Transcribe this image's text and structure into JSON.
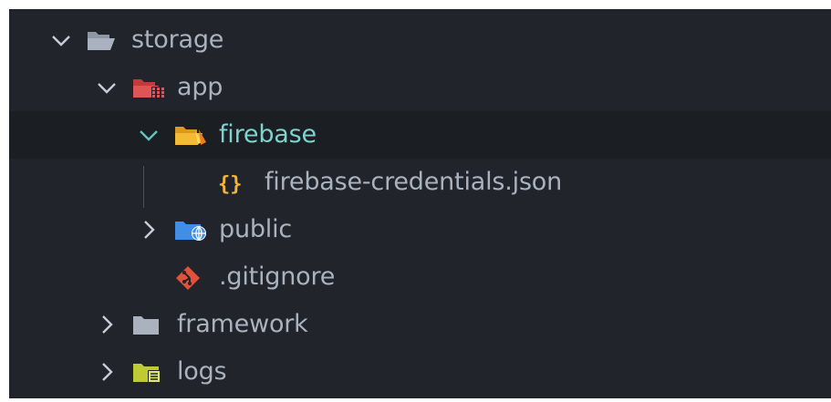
{
  "colors": {
    "background": "#21252b",
    "selected_row": "#1b1e23",
    "text": "#aab2bf",
    "active_text": "#7fd3cf",
    "chevron": "#c8ccd4"
  },
  "tree": {
    "items": [
      {
        "label": "storage",
        "icon": "folder-open-icon",
        "expanded": true
      },
      {
        "label": "app",
        "icon": "app-folder-open-icon",
        "expanded": true
      },
      {
        "label": "firebase",
        "icon": "firebase-folder-open-icon",
        "expanded": true,
        "selected": true
      },
      {
        "label": "firebase-credentials.json",
        "icon": "json-file-icon"
      },
      {
        "label": "public",
        "icon": "public-folder-icon",
        "expanded": false
      },
      {
        "label": ".gitignore",
        "icon": "git-icon"
      },
      {
        "label": "framework",
        "icon": "folder-icon",
        "expanded": false
      },
      {
        "label": "logs",
        "icon": "logs-folder-icon",
        "expanded": false
      }
    ]
  }
}
